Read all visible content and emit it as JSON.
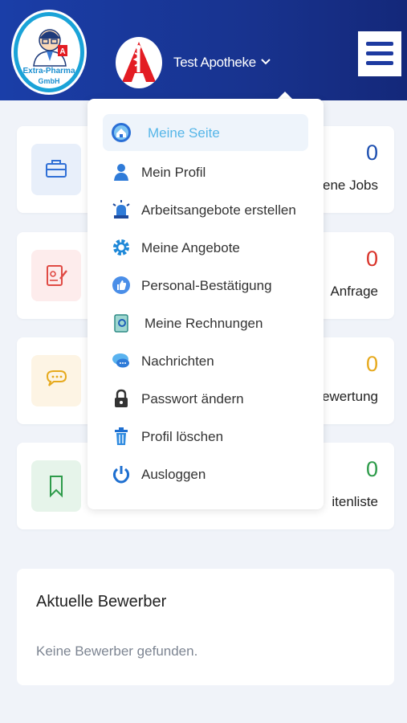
{
  "header": {
    "logo_text_line1": "Extra-Pharma",
    "logo_text_line2": "GmbH",
    "pharmacy_name": "Test Apotheke",
    "brand_color": "#1a3ea8"
  },
  "stats": [
    {
      "value": "0",
      "label": "ene Jobs",
      "icon": "briefcase-icon",
      "color": "#1d4fb0",
      "icon_bg": "#e8effa"
    },
    {
      "value": "0",
      "label": "Anfrage",
      "icon": "document-edit-icon",
      "color": "#d9342b",
      "icon_bg": "#fdecec"
    },
    {
      "value": "0",
      "label": "ewertung",
      "icon": "chat-bubble-icon",
      "color": "#e6a91c",
      "icon_bg": "#fdf4e4"
    },
    {
      "value": "0",
      "label": "itenliste",
      "icon": "bookmark-icon",
      "color": "#2d9b4a",
      "icon_bg": "#e6f4ea"
    }
  ],
  "applicants": {
    "title": "Aktuelle Bewerber",
    "empty_text": "Keine Bewerber gefunden."
  },
  "dropdown": {
    "items": [
      {
        "label": "Meine Seite",
        "icon": "home-icon",
        "active": true
      },
      {
        "label": "Mein Profil",
        "icon": "user-icon"
      },
      {
        "label": "Arbeitsangebote erstellen",
        "icon": "alarm-light-icon"
      },
      {
        "label": "Meine Angebote",
        "icon": "gear-icon"
      },
      {
        "label": "Personal-Bestätigung",
        "icon": "thumbs-up-icon"
      },
      {
        "label": "Meine Rechnungen",
        "icon": "invoice-icon"
      },
      {
        "label": "Nachrichten",
        "icon": "chat-icon"
      },
      {
        "label": "Passwort ändern",
        "icon": "lock-icon"
      },
      {
        "label": "Profil löschen",
        "icon": "trash-icon"
      },
      {
        "label": "Ausloggen",
        "icon": "power-icon"
      }
    ]
  }
}
